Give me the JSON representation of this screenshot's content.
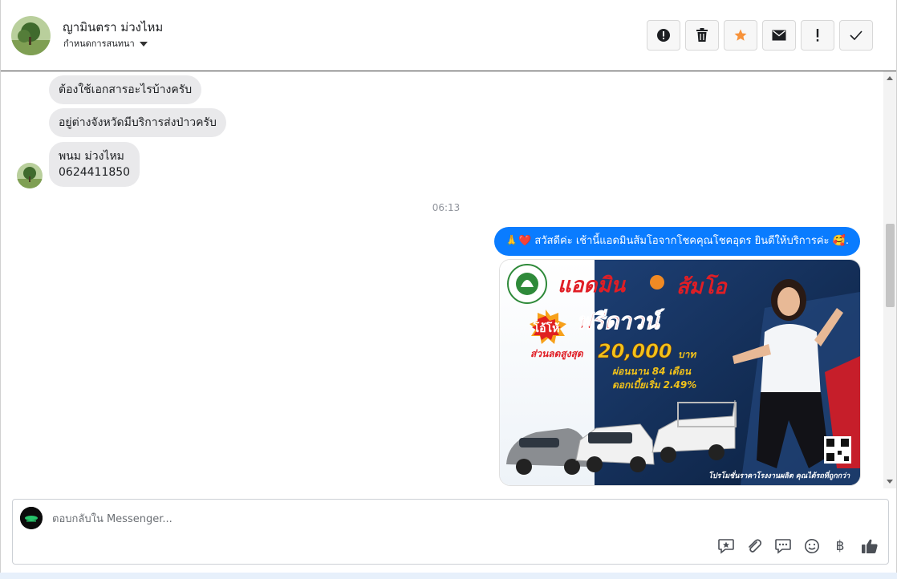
{
  "header": {
    "contact_name": "ญามินตรา ม่วงไหม",
    "assign_label": "กำหนดการสนทนา",
    "actions": [
      {
        "name": "spam-button",
        "icon": "alert-circle-icon"
      },
      {
        "name": "delete-button",
        "icon": "trash-icon"
      },
      {
        "name": "star-button",
        "icon": "star-icon"
      },
      {
        "name": "mark-unread-button",
        "icon": "envelope-icon"
      },
      {
        "name": "follow-up-button",
        "icon": "exclamation-icon"
      },
      {
        "name": "done-button",
        "icon": "check-icon"
      }
    ],
    "colors": {
      "star": "#f7923a"
    }
  },
  "thread": {
    "incoming": [
      "ต้องใช้เอกสารอะไรบ้างครับ",
      "อยู่ต่างจังหวัดมีบริการส่งป่าวครับ",
      "พนม  ม่วงไหม",
      "0624411850"
    ],
    "timestamp": "06:13",
    "outgoing_text": "สวัสดีค่ะ เช้านี้แอดมินส้มโอจากโชคคุณโชคอุดร ยินดีให้บริการค่ะ",
    "outgoing_emoji_prefix": "🙏❤️",
    "outgoing_emoji_suffix": "🥰.",
    "ad": {
      "title_left": "แอดมิน",
      "title_right": "ส้มโอ",
      "badge": "โอ้โห้",
      "headline": "ฟรีดาวน์",
      "discount_label": "ส่วนลดสูงสุด",
      "discount_amount": "20,000",
      "discount_unit": "บาท",
      "installment": "ผ่อนนาน 84 เดือน",
      "interest": "ดอกเบี้ยเริ่ม 2.49%",
      "footer": "โปรโมชั่นราคาโรงงานผลิต คุณได้รถที่ถูกกว่า"
    }
  },
  "composer": {
    "placeholder": "ตอบกลับใน Messenger...",
    "icons": [
      "saved-reply-icon",
      "paperclip-icon",
      "chat-bubble-icon",
      "smiley-icon",
      "baht-icon",
      "thumbs-up-icon"
    ],
    "baht_symbol": "฿"
  }
}
